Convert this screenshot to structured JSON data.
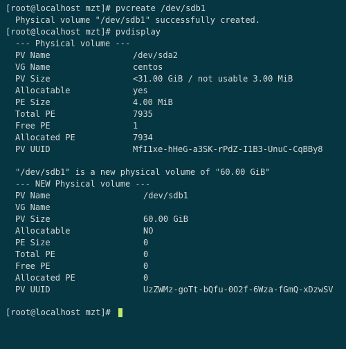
{
  "prompt1": {
    "open": "[",
    "user": "root@localhost",
    "sep": " ",
    "path": "mzt",
    "close": "]# ",
    "command": "pvcreate /dev/sdb1"
  },
  "pvcreate_output": "Physical volume \"/dev/sdb1\" successfully created.",
  "prompt2": {
    "open": "[",
    "user": "root@localhost",
    "sep": " ",
    "path": "mzt",
    "close": "]# ",
    "command": "pvdisplay"
  },
  "pv_current": {
    "header": "--- Physical volume ---",
    "rows": [
      {
        "label": "PV Name",
        "value": "/dev/sda2"
      },
      {
        "label": "VG Name",
        "value": "centos"
      },
      {
        "label": "PV Size",
        "value": "<31.00 GiB / not usable 3.00 MiB"
      },
      {
        "label": "Allocatable",
        "value": "yes"
      },
      {
        "label": "PE Size",
        "value": "4.00 MiB"
      },
      {
        "label": "Total PE",
        "value": "7935"
      },
      {
        "label": "Free PE",
        "value": "1"
      },
      {
        "label": "Allocated PE",
        "value": "7934"
      },
      {
        "label": "PV UUID",
        "value": "MfI1xe-hHeG-a3SK-rPdZ-I1B3-UnuC-CqBBy8"
      }
    ]
  },
  "new_pv_message": "\"/dev/sdb1\" is a new physical volume of \"60.00 GiB\"",
  "pv_new": {
    "header": "--- NEW Physical volume ---",
    "rows": [
      {
        "label": "PV Name",
        "value": "/dev/sdb1"
      },
      {
        "label": "VG Name",
        "value": ""
      },
      {
        "label": "PV Size",
        "value": "60.00 GiB"
      },
      {
        "label": "Allocatable",
        "value": "NO"
      },
      {
        "label": "PE Size",
        "value": "0"
      },
      {
        "label": "Total PE",
        "value": "0"
      },
      {
        "label": "Free PE",
        "value": "0"
      },
      {
        "label": "Allocated PE",
        "value": "0"
      },
      {
        "label": "PV UUID",
        "value": "UzZWMz-goTt-bQfu-0O2f-6Wza-fGmQ-xDzwSV"
      }
    ]
  },
  "prompt3": {
    "open": "[",
    "user": "root@localhost",
    "sep": " ",
    "path": "mzt",
    "close": "]# "
  }
}
